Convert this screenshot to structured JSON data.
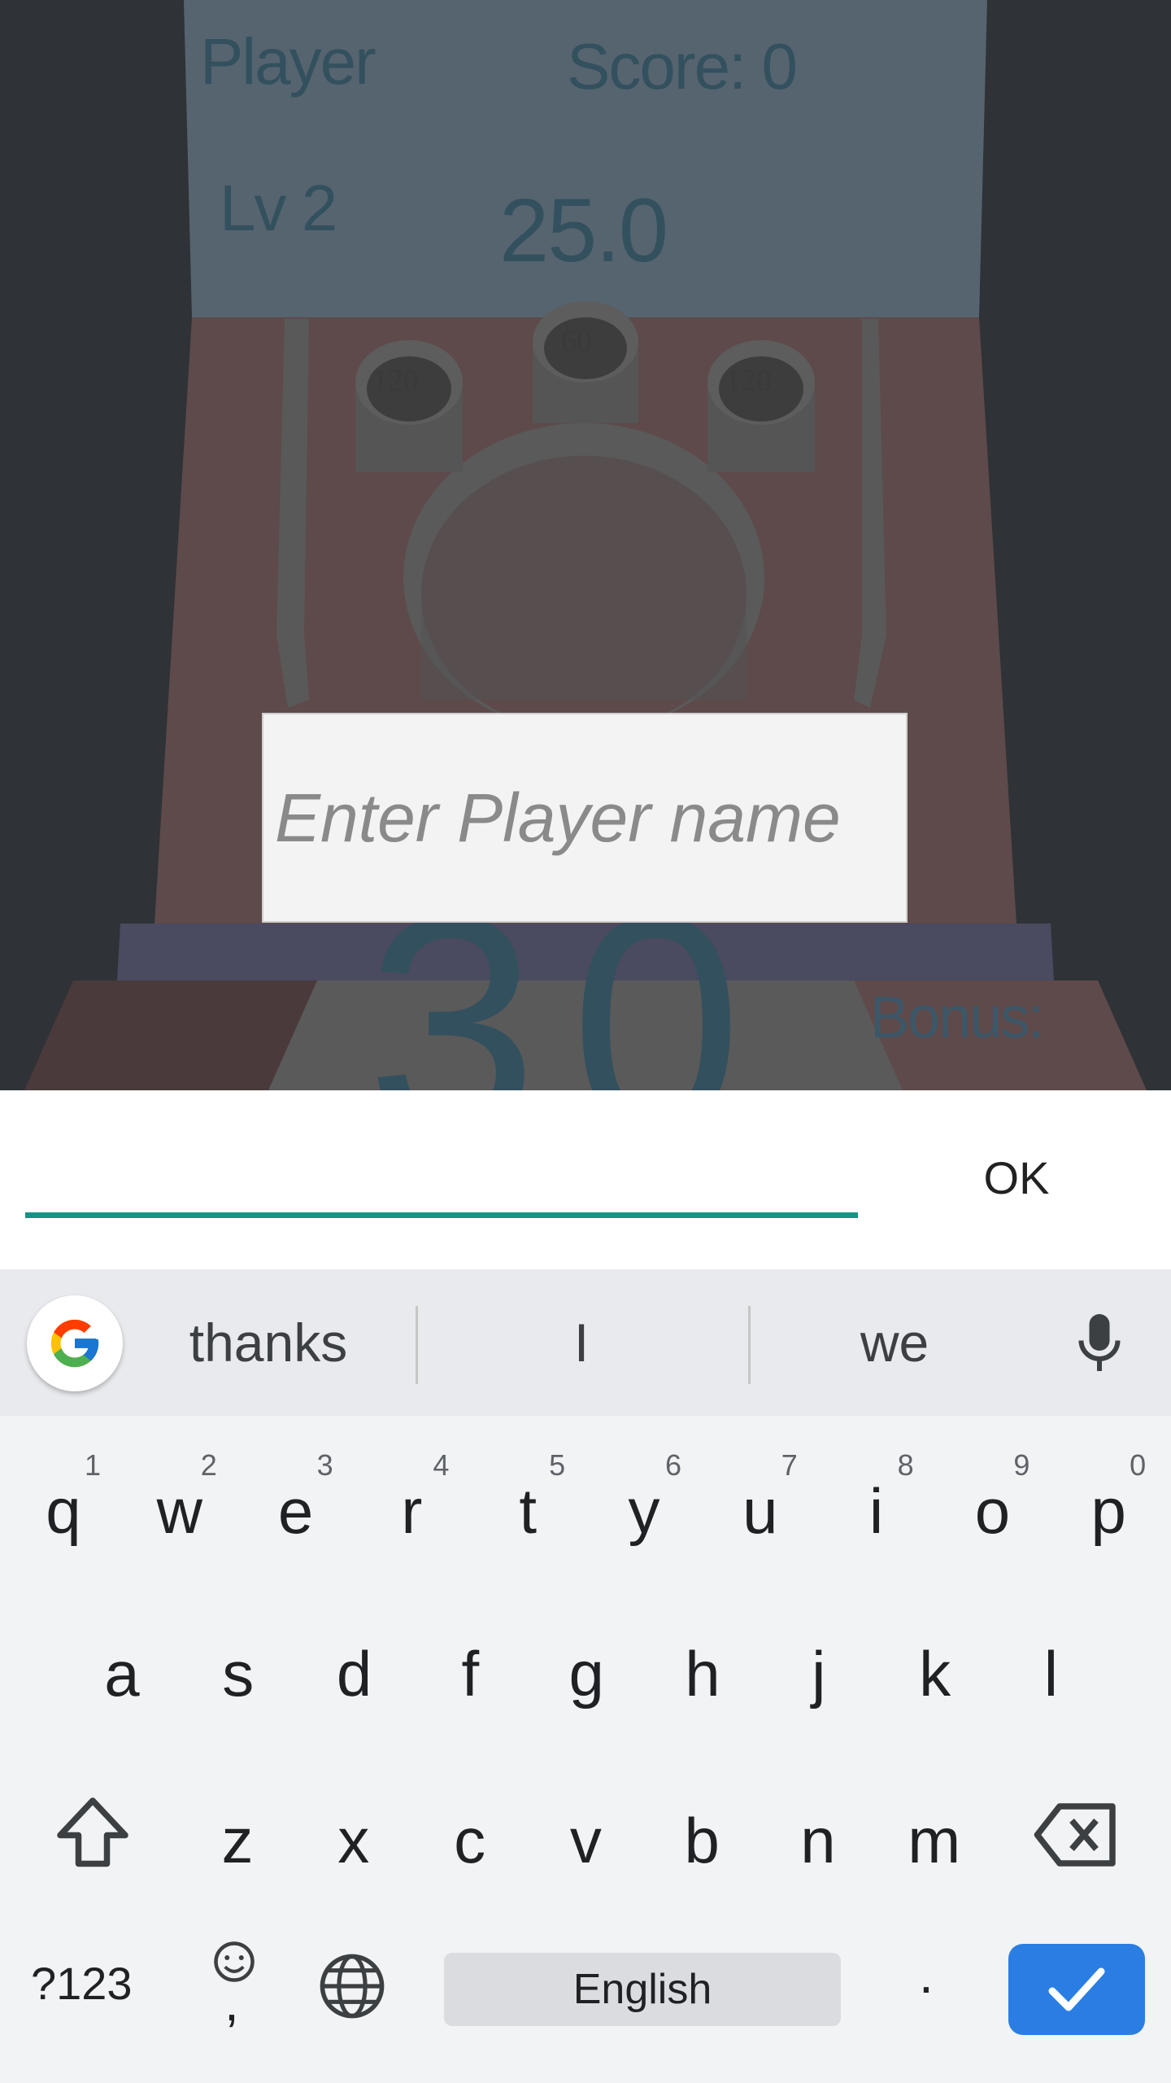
{
  "game": {
    "player_label": "Player",
    "score_text": "Score: 0",
    "level_text": "Lv 2",
    "timer_text": "25.0",
    "big_number_text": "30",
    "bonus_text": "Bonus:",
    "cups": [
      {
        "label": "120"
      },
      {
        "label": "60"
      },
      {
        "label": "120"
      }
    ],
    "name_input": {
      "placeholder": "Enter Player name"
    }
  },
  "dialog": {
    "input_value": "",
    "ok_label": "OK"
  },
  "keyboard": {
    "suggestions": [
      "thanks",
      "I",
      "we"
    ],
    "row1": [
      {
        "ch": "q",
        "hint": "1"
      },
      {
        "ch": "w",
        "hint": "2"
      },
      {
        "ch": "e",
        "hint": "3"
      },
      {
        "ch": "r",
        "hint": "4"
      },
      {
        "ch": "t",
        "hint": "5"
      },
      {
        "ch": "y",
        "hint": "6"
      },
      {
        "ch": "u",
        "hint": "7"
      },
      {
        "ch": "i",
        "hint": "8"
      },
      {
        "ch": "o",
        "hint": "9"
      },
      {
        "ch": "p",
        "hint": "0"
      }
    ],
    "row2": [
      "a",
      "s",
      "d",
      "f",
      "g",
      "h",
      "j",
      "k",
      "l"
    ],
    "row3": [
      "z",
      "x",
      "c",
      "v",
      "b",
      "n",
      "m"
    ],
    "symbols_label": "?123",
    "comma_label": ",",
    "space_label": "English",
    "period_label": ".",
    "colors": {
      "accent": "#139484",
      "enter": "#2a7ee3"
    },
    "icons": [
      "google-icon",
      "microphone-icon",
      "shift-icon",
      "backspace-icon",
      "emoji-icon",
      "globe-icon",
      "checkmark-icon"
    ]
  }
}
